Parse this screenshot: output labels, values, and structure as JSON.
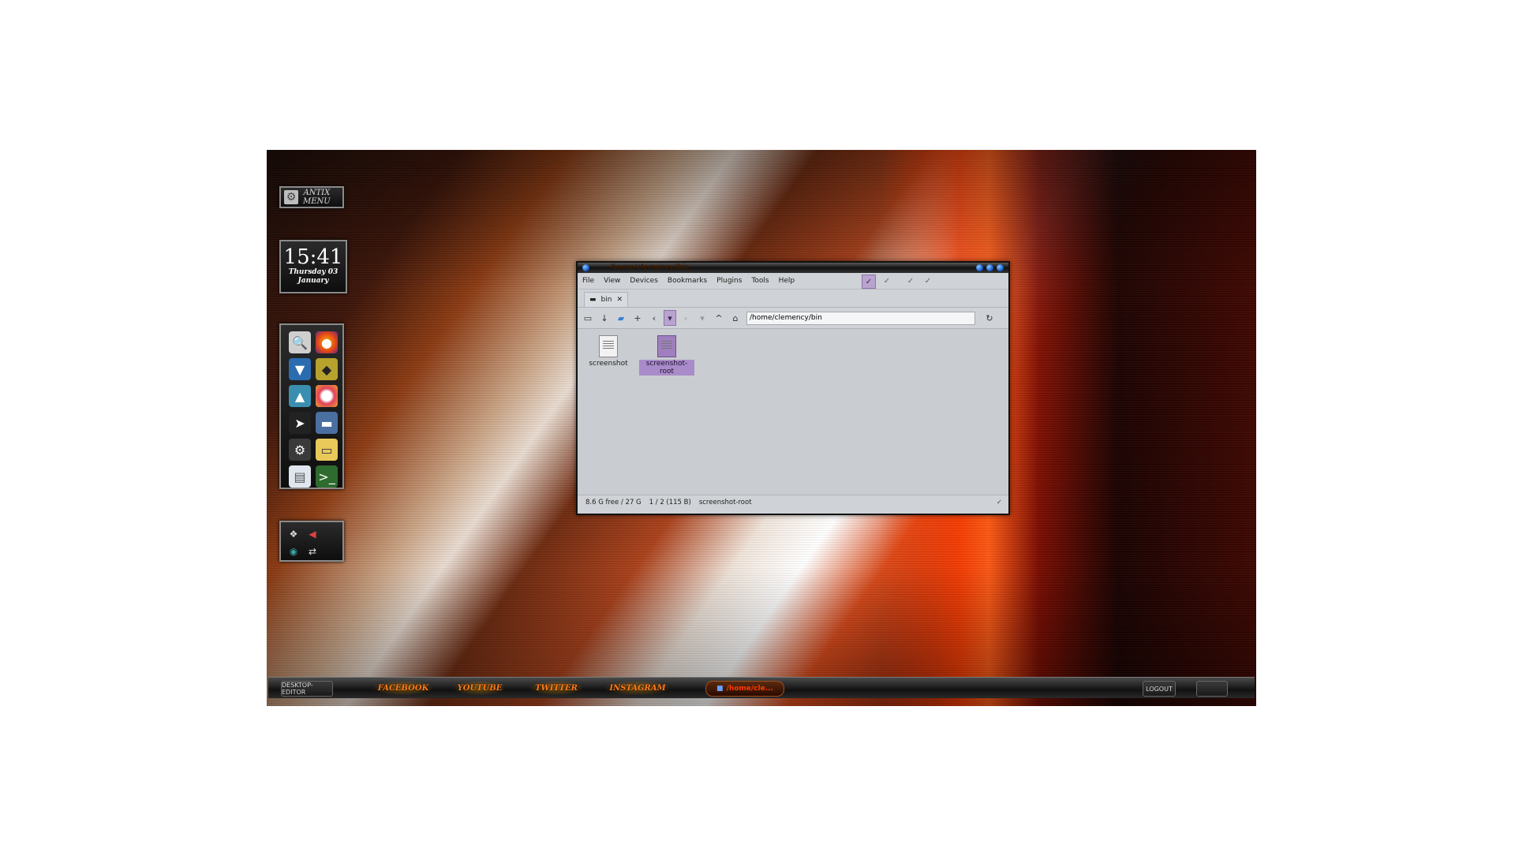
{
  "desktop": {
    "menu": {
      "line1": "ANTIX",
      "line2": "MENU"
    },
    "clock": {
      "time": "15:41",
      "day": "Thursday 03",
      "month": "January"
    },
    "launcher_icons": [
      "search-tool-icon",
      "firefox-icon",
      "tie-icon",
      "cat-icon",
      "hat-icon",
      "camera-ring-icon",
      "paper-plane-icon",
      "train-icon",
      "gear-icon",
      "folder-icon",
      "window-icon",
      "terminal-icon"
    ],
    "tray_icons": [
      "dropbox-icon",
      "volume-icon",
      "network-globe-icon",
      "network-icon"
    ]
  },
  "bottombar": {
    "desktop_editor": "DESKTOP-EDITOR",
    "facebook": "FACEBOOK",
    "youtube": "YOUTUBE",
    "twitter": "TWITTER",
    "instagram": "INSTAGRAM",
    "task": "/home/cle...",
    "logout": "LOGOUT",
    "extra": ""
  },
  "window": {
    "title": "/home/clemency/bin",
    "menu": [
      "File",
      "View",
      "Devices",
      "Bookmarks",
      "Plugins",
      "Tools",
      "Help"
    ],
    "tab": {
      "label": "bin",
      "close": "✕"
    },
    "path": "/home/clemency/bin",
    "files": [
      {
        "name": "screenshot",
        "selected": false
      },
      {
        "name": "screenshot-root",
        "selected": true
      }
    ],
    "status": {
      "free": "8.6 G free / 27 G",
      "count": "1 / 2 (115 B)",
      "selected": "screenshot-root",
      "check": "✓"
    }
  }
}
